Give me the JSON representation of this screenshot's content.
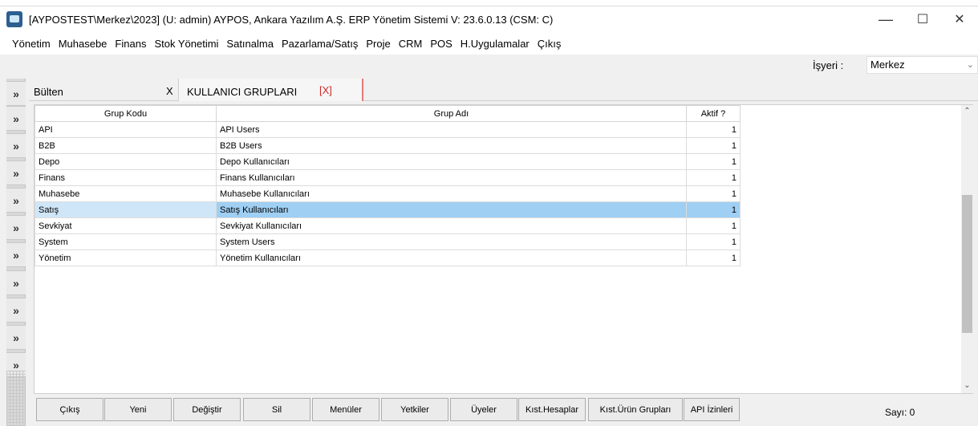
{
  "window": {
    "title": "[AYPOSTEST\\Merkez\\2023] (U: admin) AYPOS, Ankara Yazılım A.Ş. ERP Yönetim Sistemi V: 23.6.0.13 (CSM: C)",
    "minimize": "—",
    "maximize": "☐",
    "close": "✕"
  },
  "menu": [
    "Yönetim",
    "Muhasebe",
    "Finans",
    "Stok Yönetimi",
    "Satınalma",
    "Pazarlama/Satış",
    "Proje",
    "CRM",
    "POS",
    "H.Uygulamalar",
    "Çıkış"
  ],
  "workplace": {
    "label": "İşyeri :",
    "value": "Merkez"
  },
  "left_strip": {
    "button_glyph": "»"
  },
  "tabs": {
    "bulten": {
      "label": "Bülten",
      "close": "X"
    },
    "active": {
      "label": "KULLANICI GRUPLARI",
      "close": "[X]"
    }
  },
  "grid": {
    "headers": [
      "Grup Kodu",
      "Grup Adı",
      "Aktif ?"
    ],
    "rows": [
      [
        "API",
        "API Users",
        "1"
      ],
      [
        "B2B",
        "B2B Users",
        "1"
      ],
      [
        "Depo",
        "Depo Kullanıcıları",
        "1"
      ],
      [
        "Finans",
        "Finans Kullanıcıları",
        "1"
      ],
      [
        "Muhasebe",
        "Muhasebe Kullanıcıları",
        "1"
      ],
      [
        "Satış",
        "Satış Kullanıcıları",
        "1"
      ],
      [
        "Sevkiyat",
        "Sevkiyat Kullanıcıları",
        "1"
      ],
      [
        "System",
        "System Users",
        "1"
      ],
      [
        "Yönetim",
        "Yönetim Kullanıcıları",
        "1"
      ]
    ],
    "selected_row": 5
  },
  "buttons": [
    "Çıkış",
    "Yeni",
    "Değiştir",
    "Sil",
    "Menüler",
    "Yetkiler",
    "Üyeler",
    "Kıst.Hesaplar",
    "Kıst.Ürün Grupları",
    "API İzinleri"
  ],
  "count": "Sayı: 0",
  "colors": {
    "selection": "#9fcff3",
    "tab_close": "#d02a2a",
    "tab_border": "#e57a7a"
  }
}
